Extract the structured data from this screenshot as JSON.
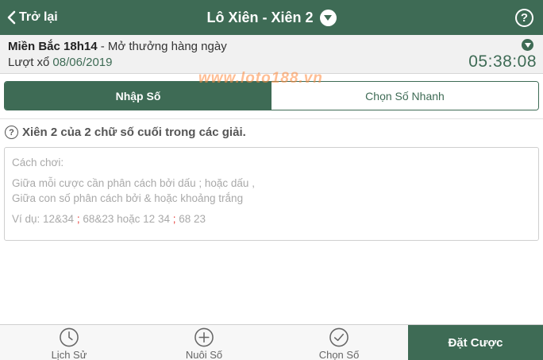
{
  "header": {
    "back_label": "Trở lại",
    "title": "Lô Xiên - Xiên 2",
    "help_symbol": "?"
  },
  "draw": {
    "region": "Miền Bắc 18h14",
    "schedule": " - Mở thưởng hàng ngày",
    "round_label": "Lượt xổ",
    "round_date": "08/06/2019",
    "countdown": "05:38:08"
  },
  "tabs": [
    {
      "label": "Nhập Số",
      "active": true
    },
    {
      "label": "Chọn Số Nhanh",
      "active": false
    }
  ],
  "watermark": "www.loto188.vn",
  "description": {
    "icon_symbol": "?",
    "text": "Xiên 2 của 2 chữ số cuối trong các giải."
  },
  "input": {
    "line1": "Cách chơi:",
    "line2": "Giữa mỗi cược cần phân cách bởi dấu ; hoặc dấu ,",
    "line3": "Giữa con số phân cách bởi & hoặc khoảng trắng",
    "example_prefix": "Ví dụ: 12&34",
    "semicolon": ";",
    "example_mid": "68&23 hoặc 12 34",
    "example_end": "68 23"
  },
  "bottom_nav": [
    {
      "label": "Lịch Sử",
      "icon": "clock-icon"
    },
    {
      "label": "Nuôi Số",
      "icon": "plus-circle-icon"
    },
    {
      "label": "Chọn Số",
      "icon": "check-circle-icon"
    }
  ],
  "bet_button_label": "Đặt Cược",
  "colors": {
    "primary": "#3e6b55",
    "accent_red": "#e53935",
    "watermark": "#ff8a3d"
  }
}
